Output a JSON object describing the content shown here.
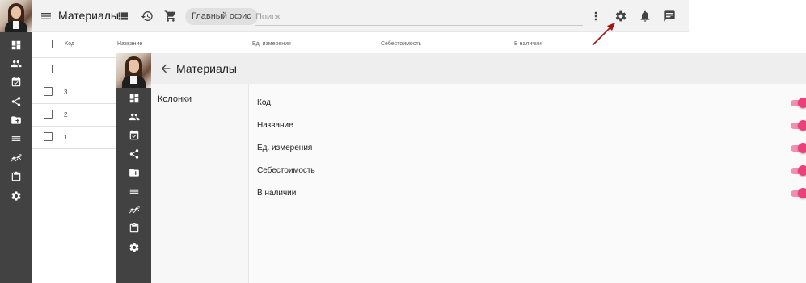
{
  "back_window": {
    "title": "Материалы",
    "office_chip": "Главный офис",
    "search": {
      "placeholder": "Поиск"
    },
    "table": {
      "headers": [
        "Код",
        "Название",
        "Ед. измерения",
        "Себестоимость",
        "В наличии"
      ],
      "rows": [
        {
          "code": ""
        },
        {
          "code": "3"
        },
        {
          "code": "2"
        },
        {
          "code": "1"
        }
      ]
    },
    "sidebar_icons": [
      "dashboard-icon",
      "people-icon",
      "event-check-icon",
      "share-icon",
      "folder-icon",
      "list-icon",
      "trend-icon",
      "clipboard-icon",
      "gear-icon"
    ],
    "toolbar_icons": [
      "menu-icon",
      "list-icon",
      "history-icon",
      "cart-icon",
      "more-vert-icon",
      "gear-icon",
      "bell-icon",
      "chat-icon"
    ]
  },
  "front_window": {
    "title": "Материалы",
    "section_label": "Колонки",
    "columns": [
      {
        "label": "Код",
        "enabled": true
      },
      {
        "label": "Название",
        "enabled": true
      },
      {
        "label": "Ед. измерения",
        "enabled": true
      },
      {
        "label": "Себестоимость",
        "enabled": true
      },
      {
        "label": "В наличии",
        "enabled": true
      }
    ]
  },
  "colors": {
    "sidebar": "#424242",
    "toggle_accent": "#ec407a",
    "annotation_arrow": "#a31515"
  }
}
